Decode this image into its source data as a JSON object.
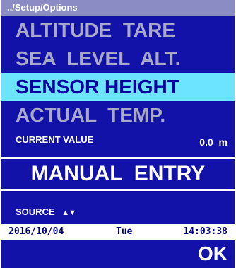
{
  "path": "../Setup/Options",
  "menu": {
    "items": [
      {
        "label": "ALTITUDE  TARE",
        "selected": false
      },
      {
        "label": "SEA  LEVEL  ALT.",
        "selected": false
      },
      {
        "label": "SENSOR HEIGHT",
        "selected": true
      },
      {
        "label": "ACTUAL  TEMP.",
        "selected": false
      }
    ]
  },
  "current": {
    "label": "CURRENT VALUE",
    "value": "0.0  m"
  },
  "manual_entry_label": "MANUAL  ENTRY",
  "source": {
    "label": "SOURCE",
    "arrows_icon": "up-down-arrows-icon",
    "arrows": "▲▼"
  },
  "status": {
    "date": "2016/10/04",
    "day": "Tue",
    "time": "14:03:38"
  },
  "softkey": {
    "ok_label": "OK"
  },
  "colors": {
    "background": "#1212a8",
    "highlight": "#6ce4ff",
    "inactive_text": "#a8a8c8",
    "path_bar": "#8c8cc4"
  }
}
